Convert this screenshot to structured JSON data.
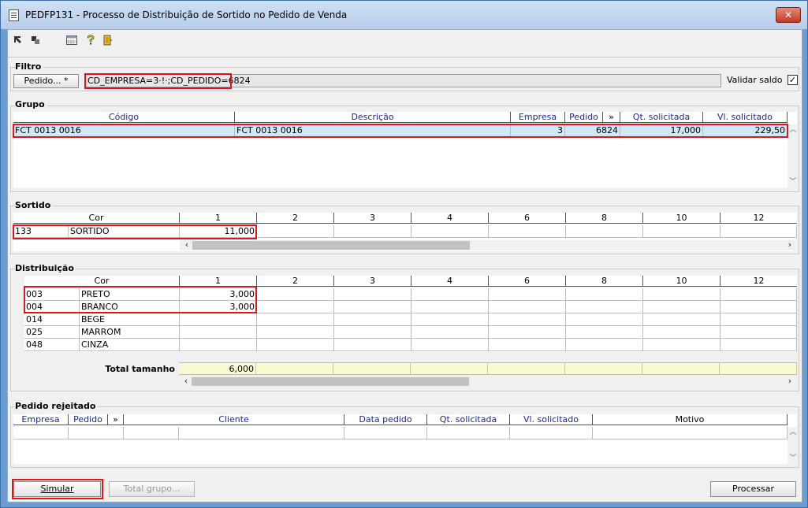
{
  "window": {
    "title": "PEDFP131 - Processo de Distribuição de Sortido no Pedido de Venda",
    "close_glyph": "✕"
  },
  "toolbar": {
    "icons": [
      "arrow-in-icon",
      "arrow-out-icon",
      "calendar-icon",
      "help-icon",
      "exit-door-icon"
    ]
  },
  "filtro": {
    "label": "Filtro",
    "pedido_button": "Pedido... *",
    "filter_value": "CD_EMPRESA=3·!·;CD_PEDIDO=6824",
    "validar_saldo_label": "Validar saldo",
    "validar_saldo_checked": "✓"
  },
  "grupo": {
    "label": "Grupo",
    "columns": [
      "Código",
      "Descrição",
      "Empresa",
      "Pedido",
      "»",
      "Qt. solicitada",
      "Vl. solicitado"
    ],
    "rows": [
      {
        "codigo": "FCT 0013 0016",
        "descricao": "FCT 0013 0016",
        "empresa": "3",
        "pedido": "6824",
        "qt": "17,000",
        "vl": "229,50"
      }
    ]
  },
  "sortido": {
    "label": "Sortido",
    "columns": [
      "Cor",
      "1",
      "2",
      "3",
      "4",
      "6",
      "8",
      "10",
      "12"
    ],
    "rows": [
      {
        "cor_code": "133",
        "cor_name": "SORTIDO",
        "v1": "11,000"
      }
    ]
  },
  "distribuicao": {
    "label": "Distribuição",
    "columns": [
      "Cor",
      "1",
      "2",
      "3",
      "4",
      "6",
      "8",
      "10",
      "12"
    ],
    "rows": [
      {
        "cor_code": "003",
        "cor_name": "PRETO",
        "v1": "3,000"
      },
      {
        "cor_code": "004",
        "cor_name": "BRANCO",
        "v1": "3,000"
      },
      {
        "cor_code": "014",
        "cor_name": "BEGE",
        "v1": ""
      },
      {
        "cor_code": "025",
        "cor_name": "MARROM",
        "v1": ""
      },
      {
        "cor_code": "048",
        "cor_name": "CINZA",
        "v1": ""
      }
    ],
    "total_label": "Total tamanho",
    "total_v1": "6,000"
  },
  "rejeitado": {
    "label": "Pedido rejeitado",
    "columns": [
      "Empresa",
      "Pedido",
      "»",
      "Cliente",
      "Data pedido",
      "Qt. solicitada",
      "Vl. solicitado",
      "Motivo"
    ]
  },
  "buttons": {
    "simular": "Simular",
    "total_grupo": "Total grupo...",
    "processar": "Processar"
  },
  "colors": {
    "highlight_frame": "#e0151a",
    "selected_row": "#cde8f6",
    "total_row": "#fafad2"
  }
}
